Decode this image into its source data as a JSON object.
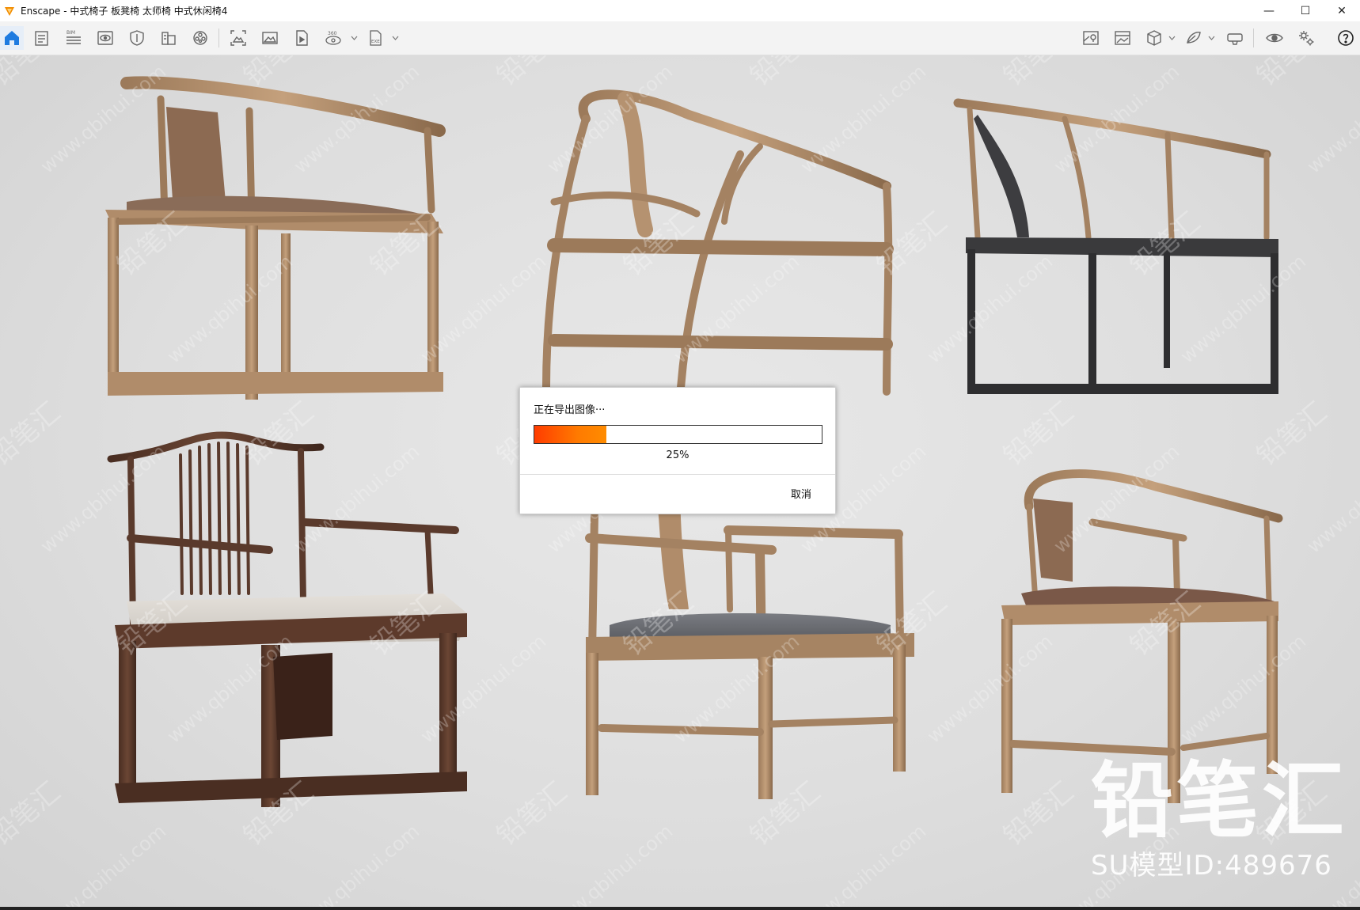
{
  "window": {
    "title": "Enscape - 中式椅子 板凳椅 太师椅 中式休闲椅4",
    "controls": {
      "minimize": "—",
      "maximize": "☐",
      "close": "✕"
    }
  },
  "toolbar": {
    "left_icons": [
      "home-icon",
      "document-icon",
      "bim-icon",
      "eye-view-icon",
      "shield-icon",
      "building-icon",
      "asset-library-icon",
      "capture-icon",
      "image-icon",
      "video-file-icon",
      "panorama-360-icon",
      "exe-export-icon"
    ],
    "right_icons": [
      "map-view-icon",
      "image-viewer-icon",
      "cube-view-icon",
      "atmosphere-icon",
      "vr-headset-icon",
      "visibility-icon",
      "settings-icon",
      "help-icon"
    ],
    "bim_label": "BIM",
    "pano_label": "360",
    "exe_label": "EXE"
  },
  "dialog": {
    "message": "正在导出图像···",
    "progress": 0.25,
    "progress_text": "25%",
    "cancel_label": "取消"
  },
  "watermark": {
    "brand_big": "铅笔汇",
    "brand_small": "SU模型ID:489676",
    "tile_cn": "铅笔汇",
    "tile_url": "www.qbihui.com"
  },
  "colors": {
    "accent": "#0078d7",
    "progress": "#ff6a00",
    "light_wood": "#b38e6a",
    "dark_wood": "#5a3a2c",
    "metal": "#3a3a3a"
  }
}
